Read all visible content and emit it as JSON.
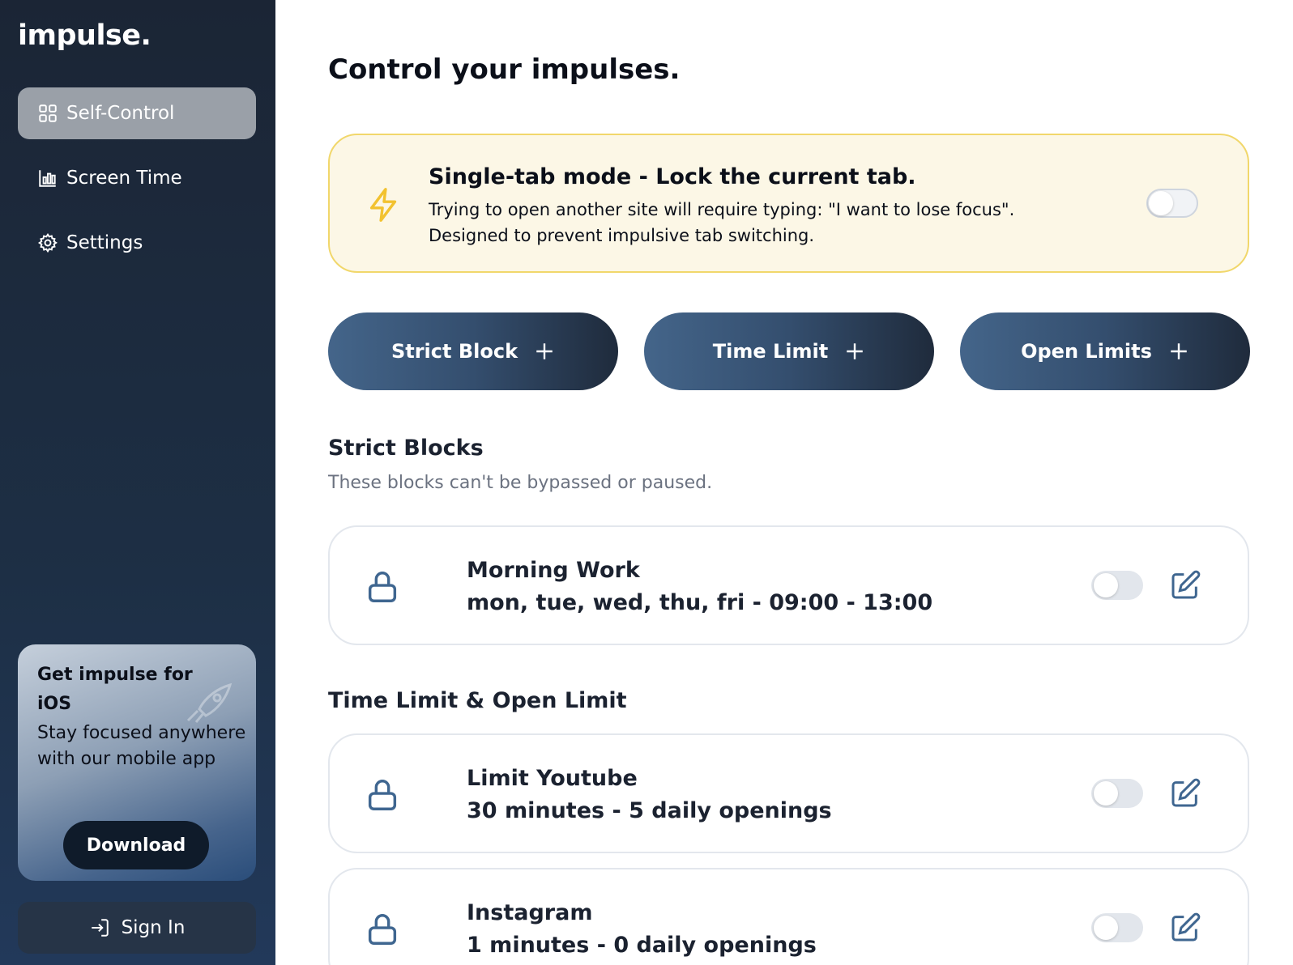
{
  "app": {
    "logo": "impulse."
  },
  "sidebar": {
    "items": [
      {
        "label": "Self-Control",
        "icon": "grid-icon",
        "active": true
      },
      {
        "label": "Screen Time",
        "icon": "bar-chart-icon",
        "active": false
      },
      {
        "label": "Settings",
        "icon": "gear-icon",
        "active": false
      }
    ],
    "promo": {
      "title": "Get impulse for iOS",
      "text_line1": "Stay focused anywhere",
      "text_line2": "with our mobile app",
      "button": "Download",
      "icon": "rocket-icon"
    },
    "signin": {
      "label": "Sign In",
      "icon": "sign-in-icon"
    }
  },
  "main": {
    "title": "Control your impulses.",
    "single_tab": {
      "title": "Single-tab mode - Lock the current tab.",
      "desc_line1": "Trying to open another site will require typing: \"I want to lose focus\".",
      "desc_line2": "Designed to prevent impulsive tab switching.",
      "enabled": false,
      "icon": "lightning-icon"
    },
    "add_buttons": [
      {
        "label": "Strict Block"
      },
      {
        "label": "Time Limit"
      },
      {
        "label": "Open Limits"
      }
    ],
    "strict_section": {
      "title": "Strict Blocks",
      "subtitle": "These blocks can't be bypassed or paused."
    },
    "strict_blocks": [
      {
        "name": "Morning Work",
        "detail": "mon, tue, wed, thu, fri - 09:00 - 13:00",
        "enabled": false
      }
    ],
    "limits_section": {
      "title": "Time Limit & Open Limit"
    },
    "limits": [
      {
        "name": "Limit Youtube",
        "detail": "30 minutes - 5 daily openings",
        "enabled": false
      },
      {
        "name": "Instagram",
        "detail": "1 minutes - 0 daily openings",
        "enabled": false
      }
    ],
    "colors": {
      "sidebar_bg": "#1b2535",
      "accent_yellow": "#f1d76b",
      "button_blue": "#44658a",
      "icon_blue": "#3f6690"
    }
  }
}
